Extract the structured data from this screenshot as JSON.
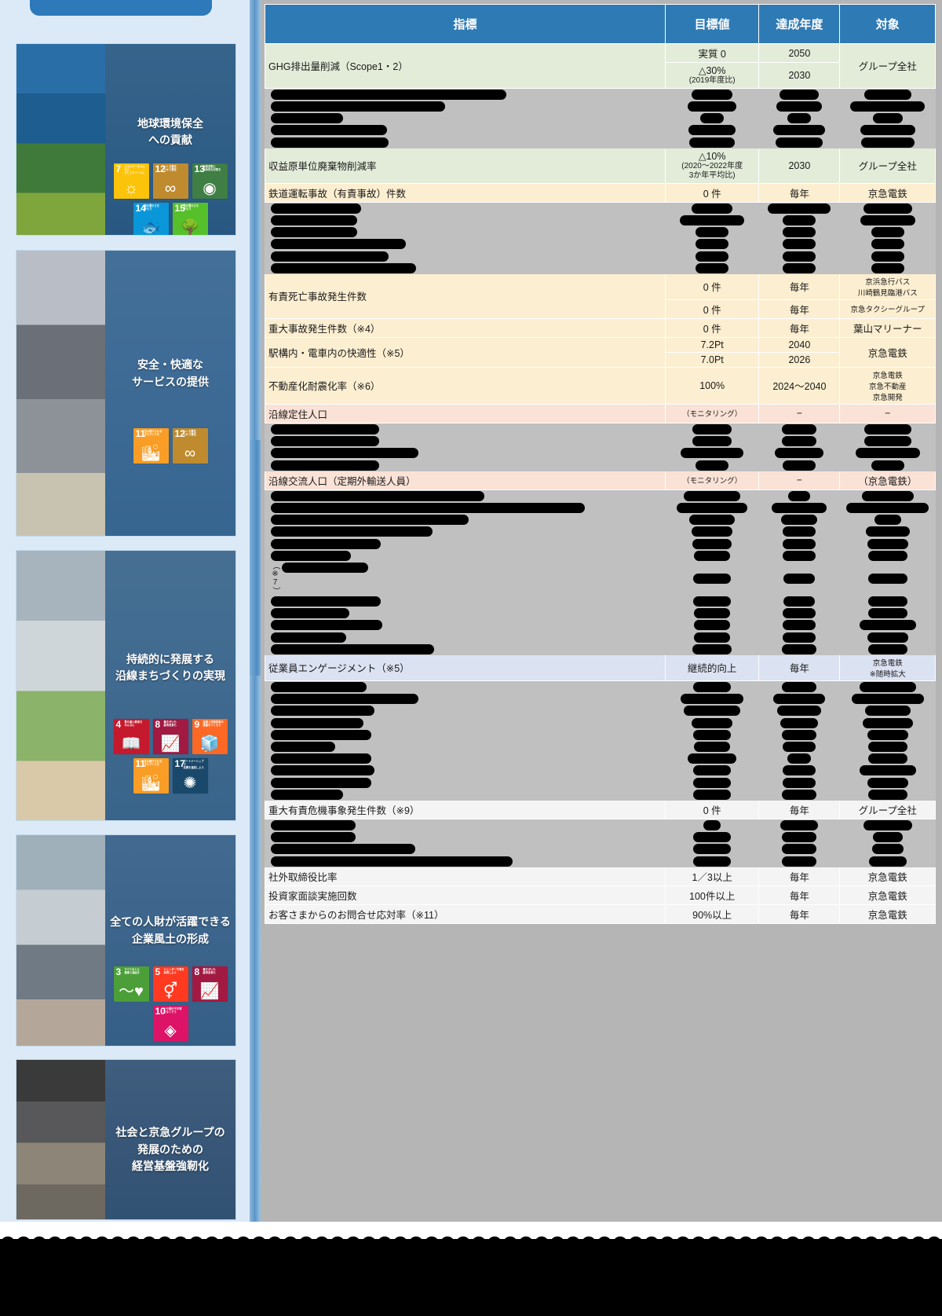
{
  "table": {
    "headers": [
      "指標",
      "目標値",
      "達成年度",
      "対象"
    ],
    "sections": [
      {
        "theme": "env",
        "rows": [
          {
            "kind": "visible",
            "indicator": "GHG排出量削減（Scope1・2）",
            "rowspan_ind": 2,
            "target": "実質 0",
            "year": "2050",
            "scope": "グループ全社",
            "rowspan_scope": 2
          },
          {
            "kind": "visible",
            "target": "△30%",
            "target_sub": "(2019年度比)",
            "year": "2030"
          },
          {
            "kind": "redacted",
            "widths": [
              300,
              52,
              50,
              60
            ]
          },
          {
            "kind": "redacted",
            "widths": [
              222,
              62,
              58,
              95
            ]
          },
          {
            "kind": "redacted",
            "widths": [
              92,
              30,
              30,
              38
            ]
          },
          {
            "kind": "redacted",
            "widths": [
              148,
              60,
              66,
              70
            ]
          },
          {
            "kind": "redacted",
            "widths": [
              150,
              58,
              60,
              68
            ]
          },
          {
            "kind": "visible",
            "indicator": "収益原単位廃棄物削減率",
            "target": "△10%",
            "target_sub": "(2020〜2022年度\n3か年平均比)",
            "year": "2030",
            "scope": "グループ全社"
          }
        ]
      },
      {
        "theme": "safe",
        "rows": [
          {
            "kind": "visible",
            "indicator": "鉄道運転事故（有責事故）件数",
            "target": "0 件",
            "year": "毎年",
            "scope": "京急電鉄"
          },
          {
            "kind": "redacted",
            "widths": [
              115,
              52,
              80,
              62
            ]
          },
          {
            "kind": "redacted",
            "widths": [
              110,
              82,
              42,
              70
            ]
          },
          {
            "kind": "redacted",
            "widths": [
              110,
              42,
              42,
              42
            ]
          },
          {
            "kind": "redacted",
            "widths": [
              172,
              42,
              42,
              42
            ]
          },
          {
            "kind": "redacted",
            "widths": [
              150,
              42,
              42,
              42
            ]
          },
          {
            "kind": "redacted",
            "widths": [
              185,
              42,
              42,
              42
            ]
          },
          {
            "kind": "visible",
            "indicator": "有責死亡事故発生件数",
            "rowspan_ind": 2,
            "target": "0 件",
            "year": "毎年",
            "scope": "京浜急行バス\n川崎鶴見臨港バス"
          },
          {
            "kind": "visible",
            "target": "0 件",
            "year": "毎年",
            "scope": "京急タクシーグループ"
          },
          {
            "kind": "visible",
            "indicator": "重大事故発生件数（※4）",
            "target": "0 件",
            "year": "毎年",
            "scope": "葉山マリーナー"
          },
          {
            "kind": "visible",
            "indicator": "駅構内・電車内の快適性（※5）",
            "rowspan_ind": 2,
            "target": "7.2Pt",
            "year": "2040",
            "scope": "京急電鉄",
            "rowspan_scope": 2
          },
          {
            "kind": "visible",
            "target": "7.0Pt",
            "year": "2026"
          },
          {
            "kind": "visible",
            "indicator": "不動産化耐震化率（※6）",
            "target": "100%",
            "year": "2024〜2040",
            "scope": "京急電鉄\n京急不動産\n京急開発"
          }
        ]
      },
      {
        "theme": "town",
        "rows": [
          {
            "kind": "visible",
            "indicator": "沿線定住人口",
            "target": "（モニタリング）",
            "year": "−",
            "scope": "−"
          },
          {
            "kind": "redacted",
            "widths": [
              138,
              50,
              44,
              60
            ]
          },
          {
            "kind": "redacted",
            "widths": [
              138,
              50,
              44,
              60
            ]
          },
          {
            "kind": "redacted",
            "widths": [
              188,
              80,
              62,
              82
            ]
          },
          {
            "kind": "redacted",
            "widths": [
              138,
              42,
              42,
              42
            ]
          },
          {
            "kind": "visible",
            "indicator": "沿線交流人口（定期外輸送人員）",
            "target": "（モニタリング）",
            "year": "−",
            "scope": "（京急電鉄）"
          },
          {
            "kind": "redacted",
            "widths": [
              272,
              72,
              28,
              66
            ]
          },
          {
            "kind": "redacted",
            "widths": [
              400,
              90,
              70,
              105
            ]
          },
          {
            "kind": "redacted",
            "widths": [
              252,
              58,
              46,
              34
            ]
          },
          {
            "kind": "redacted",
            "widths": [
              206,
              52,
              42,
              56
            ]
          },
          {
            "kind": "redacted",
            "widths": [
              140,
              50,
              42,
              52
            ]
          },
          {
            "kind": "redacted",
            "widths": [
              102,
              46,
              42,
              50
            ]
          },
          {
            "kind": "redacted",
            "side_note": "（※7）",
            "widths": [
              110,
              48,
              40,
              50
            ]
          },
          {
            "kind": "redacted",
            "widths": [
              140,
              48,
              40,
              50
            ]
          },
          {
            "kind": "redacted",
            "widths": [
              100,
              46,
              42,
              50
            ]
          },
          {
            "kind": "redacted",
            "widths": [
              142,
              46,
              42,
              72
            ]
          },
          {
            "kind": "redacted",
            "widths": [
              96,
              46,
              42,
              52
            ]
          },
          {
            "kind": "redacted",
            "widths": [
              208,
              50,
              44,
              50
            ]
          }
        ]
      },
      {
        "theme": "people",
        "rows": [
          {
            "kind": "visible",
            "indicator": "従業員エンゲージメント（※5）",
            "target": "継続的向上",
            "year": "毎年",
            "scope": "京急電鉄\n※随時拡大"
          },
          {
            "kind": "redacted",
            "widths": [
              122,
              48,
              44,
              72
            ]
          },
          {
            "kind": "redacted",
            "widths": [
              188,
              80,
              66,
              92
            ]
          },
          {
            "kind": "redacted",
            "widths": [
              132,
              72,
              56,
              58
            ]
          },
          {
            "kind": "redacted",
            "widths": [
              118,
              52,
              48,
              64
            ]
          },
          {
            "kind": "redacted",
            "widths": [
              128,
              48,
              44,
              52
            ]
          },
          {
            "kind": "redacted",
            "widths": [
              82,
              46,
              42,
              50
            ]
          },
          {
            "kind": "redacted",
            "widths": [
              128,
              62,
              30,
              50
            ]
          },
          {
            "kind": "redacted",
            "widths": [
              132,
              48,
              42,
              72
            ]
          },
          {
            "kind": "redacted",
            "widths": [
              128,
              48,
              42,
              52
            ]
          },
          {
            "kind": "redacted",
            "widths": [
              92,
              48,
              44,
              50
            ]
          }
        ]
      },
      {
        "theme": "mgmt",
        "rows": [
          {
            "kind": "visible",
            "indicator": "重大有責危機事象発生件数（※9）",
            "target": "0 件",
            "year": "毎年",
            "scope": "グループ全社"
          },
          {
            "kind": "redacted",
            "widths": [
              108,
              22,
              48,
              62
            ]
          },
          {
            "kind": "redacted",
            "widths": [
              108,
              48,
              44,
              38
            ]
          },
          {
            "kind": "redacted",
            "widths": [
              184,
              48,
              44,
              40
            ]
          },
          {
            "kind": "redacted",
            "widths": [
              308,
              48,
              44,
              48
            ]
          },
          {
            "kind": "visible",
            "indicator": "社外取締役比率",
            "target": "1／3以上",
            "year": "毎年",
            "scope": "京急電鉄"
          },
          {
            "kind": "visible",
            "indicator": "投資家面談実施回数",
            "target": "100件以上",
            "year": "毎年",
            "scope": "京急電鉄"
          },
          {
            "kind": "visible",
            "indicator": "お客さまからのお問合せ応対率（※11）",
            "target": "90%以上",
            "year": "毎年",
            "scope": "京急電鉄"
          }
        ]
      }
    ]
  },
  "sidebar": {
    "cards": [
      {
        "id": "env",
        "title": "地球環境保全\nへの貢献",
        "photo_colors": [
          "#2a6ea8",
          "#1d5d8f",
          "#3f7a3a",
          "#7fa63c"
        ],
        "overlay": "#1d4f7a",
        "sdgs": [
          {
            "num": "7",
            "label": "エネルギーをみんなに\nそしてクリーンに",
            "color": "#fcc30b",
            "glyph": "☼"
          },
          {
            "num": "12",
            "label": "つくる責任\nつかう責任",
            "color": "#bf8b2e",
            "glyph": "∞"
          },
          {
            "num": "13",
            "label": "気候変動に\n具体的な対策を",
            "color": "#3f7e44",
            "glyph": "◉"
          },
          {
            "num": "14",
            "label": "海の豊かさを\n守ろう",
            "color": "#0a97d9",
            "glyph": "🐟"
          },
          {
            "num": "15",
            "label": "陸の豊かさも\n守ろう",
            "color": "#56c02b",
            "glyph": "🌳"
          }
        ]
      },
      {
        "id": "safety",
        "title": "安全・快適な\nサービスの提供",
        "photo_colors": [
          "#b9bec6",
          "#6b7078",
          "#8d9299",
          "#c8c3b0"
        ],
        "overlay": "#2c5d8a",
        "sdgs": [
          {
            "num": "11",
            "label": "住み続けられる\nまちづくりを",
            "color": "#f99d26",
            "glyph": "🏙"
          },
          {
            "num": "12",
            "label": "つくる責任\nつかう責任",
            "color": "#bf8b2e",
            "glyph": "∞"
          }
        ]
      },
      {
        "id": "town",
        "title": "持続的に発展する\n沿線まちづくりの実現",
        "photo_colors": [
          "#a8b4bd",
          "#cfd6da",
          "#8bb36a",
          "#d9c9a8"
        ],
        "overlay": "#2f5c84",
        "sdgs": [
          {
            "num": "4",
            "label": "質の高い教育を\nみんなに",
            "color": "#c5192d",
            "glyph": "📖"
          },
          {
            "num": "8",
            "label": "働きがいも\n経済成長も",
            "color": "#a21942",
            "glyph": "📈"
          },
          {
            "num": "9",
            "label": "産業と技術革新の\n基盤をつくろう",
            "color": "#fd6925",
            "glyph": "🧊"
          },
          {
            "num": "11",
            "label": "住み続けられる\nまちづくりを",
            "color": "#f99d26",
            "glyph": "🏙"
          },
          {
            "num": "17",
            "label": "パートナーシップで\n目標を達成しよう",
            "color": "#19486a",
            "glyph": "✺"
          }
        ]
      },
      {
        "id": "people",
        "title": "全ての人財が活躍できる\n企業風土の形成",
        "photo_colors": [
          "#9fb0bb",
          "#c6cdd2",
          "#6f7a84",
          "#b4a79a"
        ],
        "overlay": "#2b5680",
        "sdgs": [
          {
            "num": "3",
            "label": "すべての人に\n健康と福祉を",
            "color": "#4c9f38",
            "glyph": "〜♥"
          },
          {
            "num": "5",
            "label": "ジェンダー平等を\n実現しよう",
            "color": "#ff3a21",
            "glyph": "⚥"
          },
          {
            "num": "8",
            "label": "働きがいも\n経済成長も",
            "color": "#a21942",
            "glyph": "📈"
          },
          {
            "num": "10",
            "label": "人や国の不平等\nをなくそう",
            "color": "#dd1367",
            "glyph": "◈"
          }
        ]
      },
      {
        "id": "mgmt",
        "title": "社会と京急グループの\n発展のための\n経営基盤強靭化",
        "photo_colors": [
          "#3a3a3a",
          "#58585a",
          "#8d8577",
          "#6d6860"
        ],
        "overlay": "#27486b",
        "sdgs": []
      }
    ]
  }
}
